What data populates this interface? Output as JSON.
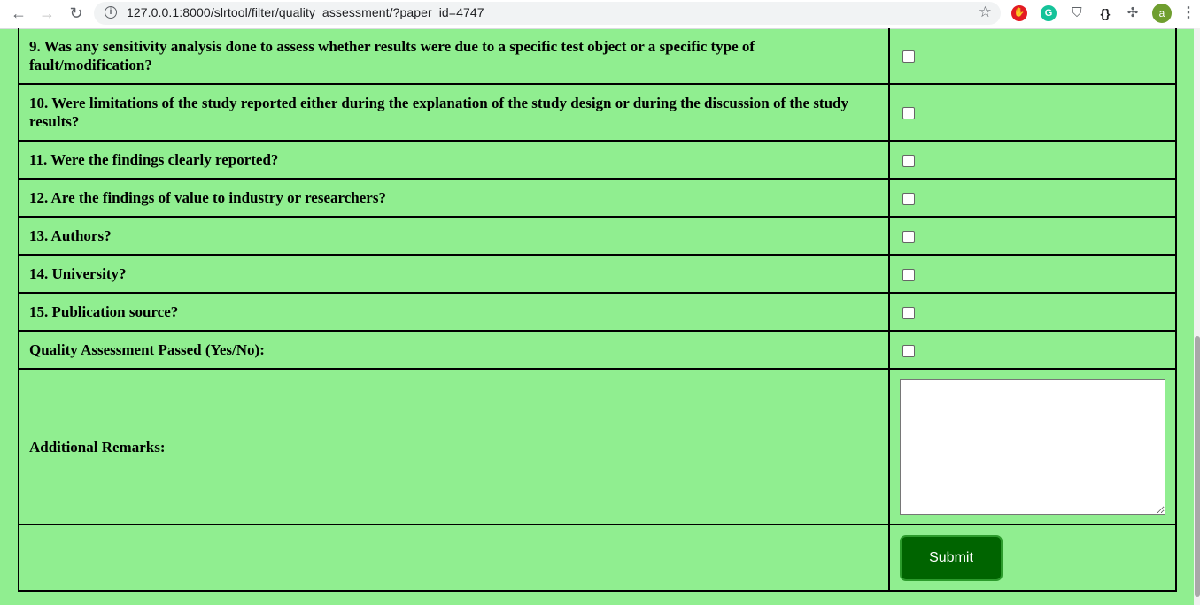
{
  "browser": {
    "url": "127.0.0.1:8000/slrtool/filter/quality_assessment/?paper_id=4747",
    "back_glyph": "←",
    "forward_glyph": "→",
    "reload_glyph": "↻",
    "info_glyph": "i",
    "star_glyph": "☆",
    "ext_stop": "✋",
    "ext_grammarly": "G",
    "ext_pocket": "⛉",
    "ext_braces": "{}",
    "ext_puzzle": "✣",
    "avatar_letter": "a",
    "menu_glyph": "⋮"
  },
  "questions": [
    {
      "label": "9. Was any sensitivity analysis done to assess whether results were due to a specific test object or a specific type of fault/modification?",
      "checked": false
    },
    {
      "label": "10. Were limitations of the study reported either during the explanation of the study design or during the discussion of the study results?",
      "checked": false
    },
    {
      "label": "11. Were the findings clearly reported?",
      "checked": false
    },
    {
      "label": "12. Are the findings of value to industry or researchers?",
      "checked": false
    },
    {
      "label": "13. Authors?",
      "checked": false
    },
    {
      "label": "14. University?",
      "checked": false
    },
    {
      "label": "15. Publication source?",
      "checked": false
    }
  ],
  "quality_passed": {
    "label": "Quality Assessment Passed (Yes/No):",
    "checked": false
  },
  "remarks": {
    "label": "Additional Remarks:",
    "value": ""
  },
  "submit": {
    "label": "Submit"
  },
  "colors": {
    "page_bg": "#90ee90",
    "submit_bg": "#006400",
    "border": "#000000"
  }
}
